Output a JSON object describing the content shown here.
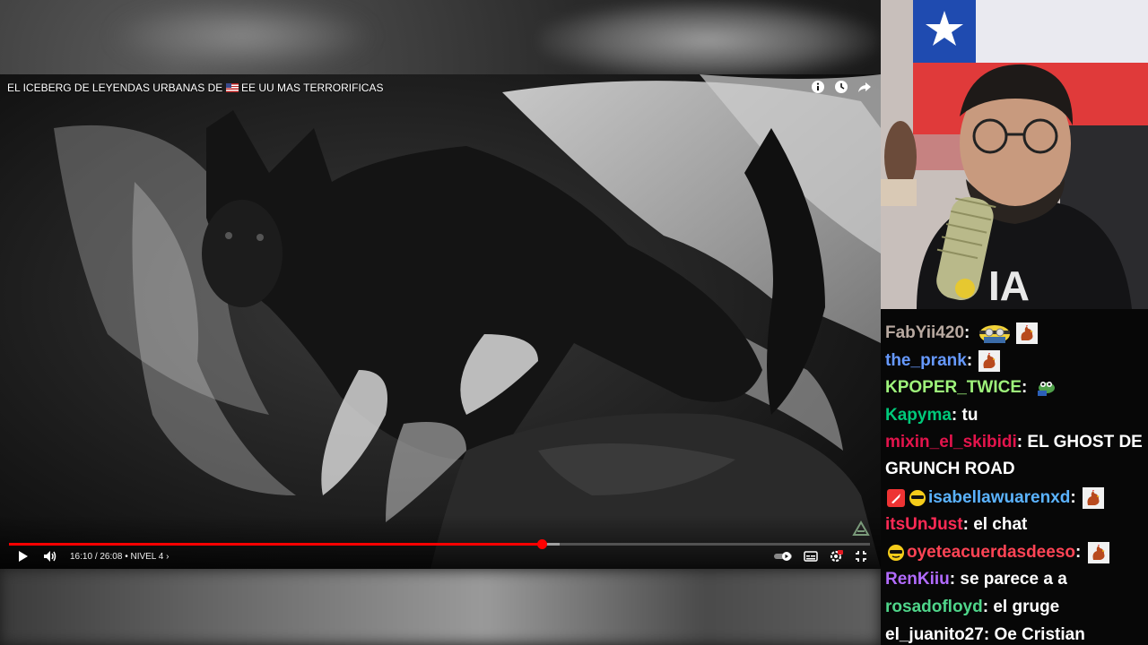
{
  "video": {
    "title_pre": "EL ICEBERG DE LEYENDAS URBANAS DE",
    "title_post": "EE UU MAS TERRORIFICAS",
    "time_current": "16:10",
    "time_total": "26:08",
    "time_separator": "/",
    "chapter": "• NIVEL 4 ›",
    "progress_fraction": 0.619,
    "buffer_fraction": 0.64,
    "top_icons": [
      "info-icon",
      "watch-later-icon",
      "share-icon"
    ],
    "control_icons": [
      "play-icon",
      "volume-icon",
      "autoplay-toggle-icon",
      "subtitles-icon",
      "settings-icon",
      "exit-fullscreen-icon"
    ]
  },
  "chat": {
    "messages": [
      {
        "user": "FabYii420",
        "color": "#b8a9a0",
        "text": "",
        "emotes": [
          "minion-emote",
          "rooster-emote"
        ]
      },
      {
        "user": "the_prank",
        "color": "#6699ff",
        "text": "",
        "emotes": [
          "rooster-emote"
        ]
      },
      {
        "user": "KPOPER_TWICE",
        "color": "#9ef37b",
        "text": "",
        "emotes": [
          "frog-emote"
        ]
      },
      {
        "user": "Kapyma",
        "color": "#00c97a",
        "text": "tu",
        "emotes": []
      },
      {
        "user": "mixin_el_skibidi",
        "color": "#e3144c",
        "text": "EL GHOST DE GRUNCH ROAD",
        "emotes": []
      },
      {
        "user": "isabellawuarenxd",
        "color": "#5bb3ff",
        "text": "",
        "emotes": [
          "rooster-emote"
        ],
        "badges": [
          "rocket-badge",
          "sunglasses-badge"
        ]
      },
      {
        "user": "itsUnJust",
        "color": "#ff2a55",
        "text": "el chat",
        "emotes": []
      },
      {
        "user": "oyeteacuerdasdeeso",
        "color": "#ff4455",
        "text": "",
        "emotes": [
          "rooster-emote"
        ],
        "badges": [
          "cool-badge"
        ]
      },
      {
        "user": "RenKiiu",
        "color": "#b26bff",
        "text": "se parece a a",
        "emotes": []
      },
      {
        "user": "rosadofloyd",
        "color": "#4fd68a",
        "text": "el gruge",
        "emotes": []
      },
      {
        "user": "el_juanito27",
        "color": "#ffffff",
        "text": "Oe Cristian",
        "emotes": []
      }
    ]
  }
}
